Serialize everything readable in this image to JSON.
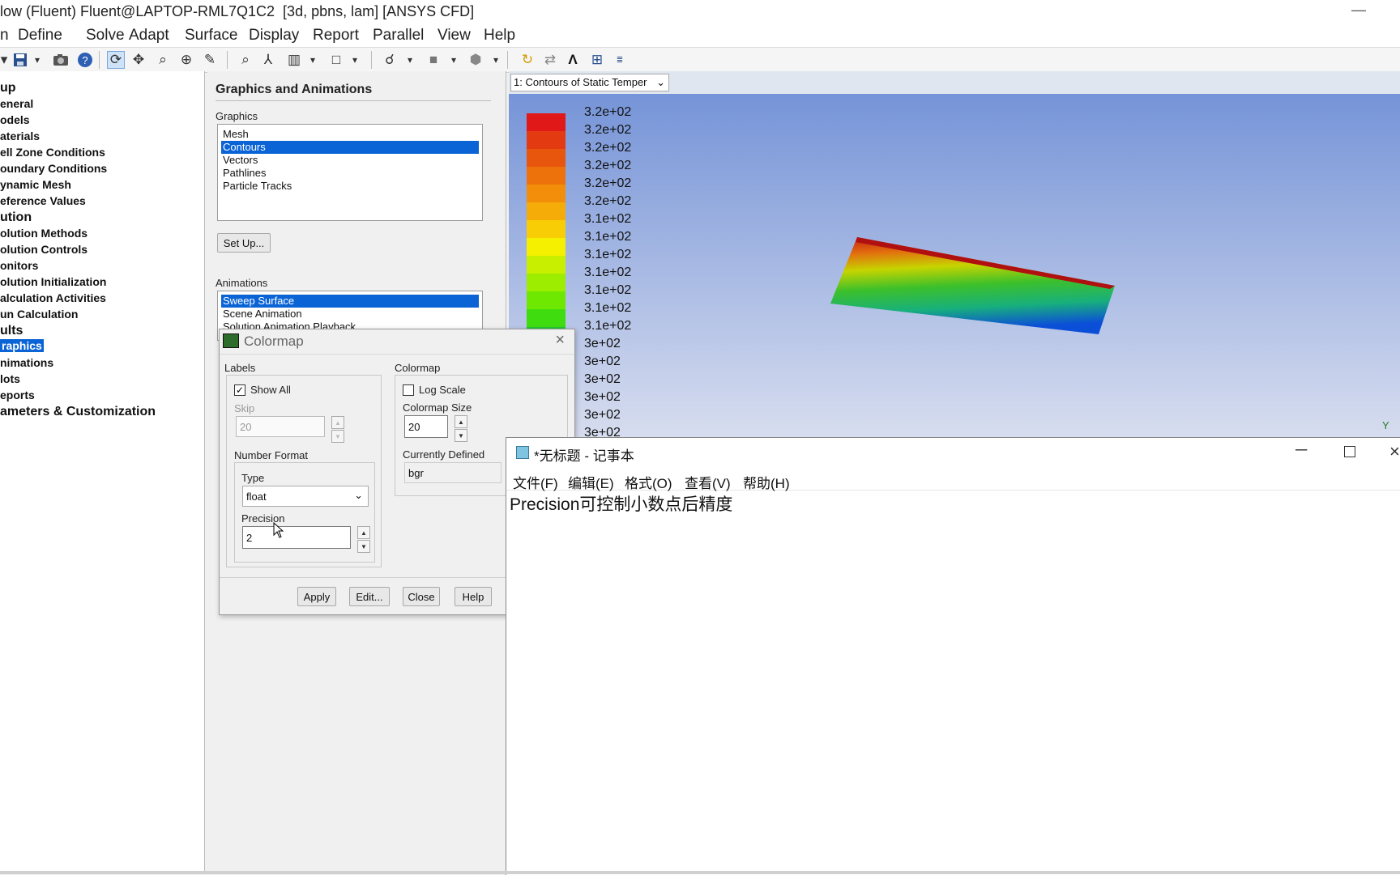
{
  "window": {
    "title": "low (Fluent) Fluent@LAPTOP-RML7Q1C2  [3d, pbns, lam] [ANSYS CFD]",
    "minimize": "—"
  },
  "menu": [
    "n",
    "Define",
    "Solve",
    "Adapt",
    "Surface",
    "Display",
    "Report",
    "Parallel",
    "View",
    "Help"
  ],
  "toolbar": {
    "icons": [
      "save-icon",
      "dropdown-icon",
      "camera-icon",
      "help-icon",
      "rotate-icon",
      "pan-icon",
      "zoom-icon",
      "zoom-in-icon",
      "probe-icon",
      "zoom-fit-icon",
      "axes-icon",
      "views-icon",
      "dropdown-icon",
      "box-icon",
      "dropdown-icon",
      "lights-icon",
      "dropdown-icon",
      "fill-icon",
      "dropdown-icon",
      "render-icon",
      "dropdown-icon",
      "refresh-icon",
      "sync-icon",
      "annotate-icon",
      "layout-icon",
      "mesh-info-icon"
    ]
  },
  "tree": {
    "items": [
      {
        "label": "up",
        "type": "header"
      },
      {
        "label": "eneral"
      },
      {
        "label": "odels"
      },
      {
        "label": "aterials"
      },
      {
        "label": "ell Zone Conditions"
      },
      {
        "label": "oundary Conditions"
      },
      {
        "label": "ynamic Mesh"
      },
      {
        "label": "eference Values"
      },
      {
        "label": "ution",
        "type": "header"
      },
      {
        "label": "olution Methods"
      },
      {
        "label": "olution Controls"
      },
      {
        "label": "onitors"
      },
      {
        "label": "olution Initialization"
      },
      {
        "label": "alculation Activities"
      },
      {
        "label": "un Calculation"
      },
      {
        "label": "ults",
        "type": "header"
      },
      {
        "label": "raphics",
        "selected": true
      },
      {
        "label": "nimations"
      },
      {
        "label": "lots"
      },
      {
        "label": "eports"
      },
      {
        "label": "ameters & Customization",
        "type": "header"
      }
    ]
  },
  "panel": {
    "title": "Graphics and Animations",
    "graphics_label": "Graphics",
    "graphics_items": [
      "Mesh",
      "Contours",
      "Vectors",
      "Pathlines",
      "Particle Tracks"
    ],
    "graphics_selected": "Contours",
    "setup_button": "Set Up...",
    "animations_label": "Animations",
    "animation_items": [
      "Sweep Surface",
      "Scene Animation",
      "Solution Animation Playback"
    ],
    "animation_selected": "Sweep Surface"
  },
  "graphics": {
    "window_select": "1: Contours of Static Temper",
    "colors": {
      "bg_top": "#6f8fd6",
      "bg_bottom": "#d7ddef"
    },
    "colorbar_labels": [
      "3.2e+02",
      "3.2e+02",
      "3.2e+02",
      "3.2e+02",
      "3.2e+02",
      "3.2e+02",
      "3.1e+02",
      "3.1e+02",
      "3.1e+02",
      "3.1e+02",
      "3.1e+02",
      "3.1e+02",
      "3.1e+02",
      "3e+02",
      "3e+02",
      "3e+02",
      "3e+02",
      "3e+02",
      "3e+02"
    ],
    "colorbar_colors": [
      "#e01818",
      "#e43a12",
      "#e8560e",
      "#ee720c",
      "#f28e0a",
      "#f5ac08",
      "#f8cd06",
      "#f4f000",
      "#c8ef00",
      "#9ced00",
      "#6ee800",
      "#3fdc10",
      "#22c832",
      "#14b858",
      "#10a87e",
      "#109aa4",
      "#0a7ccc",
      "#0a5ce0",
      "#0a3ef0"
    ],
    "axis_label": "Y"
  },
  "colormap": {
    "title": "Colormap",
    "labels_group": "Labels",
    "show_all": "Show All",
    "show_all_checked": true,
    "skip_label": "Skip",
    "skip_value": "20",
    "number_format": "Number Format",
    "type_label": "Type",
    "type_value": "float",
    "precision_label": "Precision",
    "precision_value": "2",
    "colormap_group": "Colormap",
    "log_scale": "Log Scale",
    "log_scale_checked": false,
    "size_label": "Colormap Size",
    "size_value": "20",
    "currently_defined": "Currently Defined",
    "defined_value": "bgr",
    "buttons": {
      "apply": "Apply",
      "edit": "Edit...",
      "close": "Close",
      "help": "Help"
    }
  },
  "notepad": {
    "title": "*无标题 - 记事本",
    "menu": [
      "文件(F)",
      "编辑(E)",
      "格式(O)",
      "查看(V)",
      "帮助(H)"
    ],
    "text": "Precision可控制小数点后精度"
  }
}
